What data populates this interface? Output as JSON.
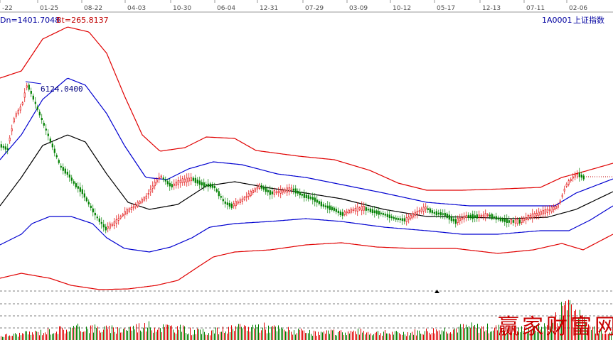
{
  "header": {
    "indicator_left": "Dn=1401.7048",
    "indicator_right": "Bt=265.8137",
    "instrument_code": "1A0001",
    "instrument_name": "上证指数"
  },
  "peak_label": "6124.0400",
  "watermark": "赢家财富网",
  "colors": {
    "top_band": "#e00000",
    "upper_band": "#0000d0",
    "middle_line": "#000000",
    "lower_band": "#0000d0",
    "bottom_band": "#e00000",
    "candle_up": "#e00000",
    "candle_down": "#008000",
    "volume_up": "#e00000",
    "volume_down": "#008000"
  },
  "chart_data": {
    "type": "line",
    "x_ticks": [
      "-22",
      "01-25",
      "08-22",
      "04-03",
      "10-30",
      "06-04",
      "12-31",
      "07-29",
      "03-09",
      "10-12",
      "05-17",
      "12-13",
      "07-11",
      "02-06"
    ],
    "annotations": [
      "6124.0400"
    ],
    "series": []
  }
}
